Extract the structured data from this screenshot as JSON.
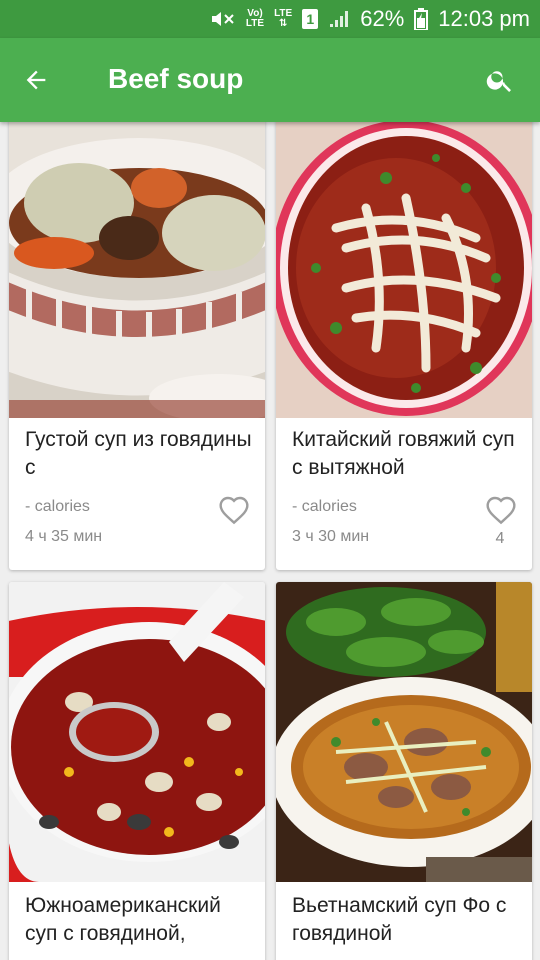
{
  "status_bar": {
    "volte_top": "Vo)",
    "volte_bottom": "LTE",
    "network": "LTE",
    "sim_slot": "1",
    "battery": "62%",
    "time": "12:03 pm"
  },
  "app_bar": {
    "title": "Beef soup",
    "back_icon": "arrow-back-icon",
    "search_icon": "search-icon"
  },
  "recipes": [
    {
      "name": "Густой суп из говядины с",
      "calories": "- calories",
      "time": "4 ч 35 мин",
      "likes": ""
    },
    {
      "name": "Китайский говяжий суп с вытяжной",
      "calories": "- calories",
      "time": "3 ч 30 мин",
      "likes": "4"
    },
    {
      "name": "Южноамериканский суп с говядиной,",
      "calories": "",
      "time": "",
      "likes": ""
    },
    {
      "name": "Вьетнамский суп Фо с говядиной",
      "calories": "",
      "time": "",
      "likes": ""
    }
  ],
  "colors": {
    "status_bar": "#3e9a40",
    "app_bar": "#4caf50",
    "heart_outline": "#9e9e9e"
  }
}
